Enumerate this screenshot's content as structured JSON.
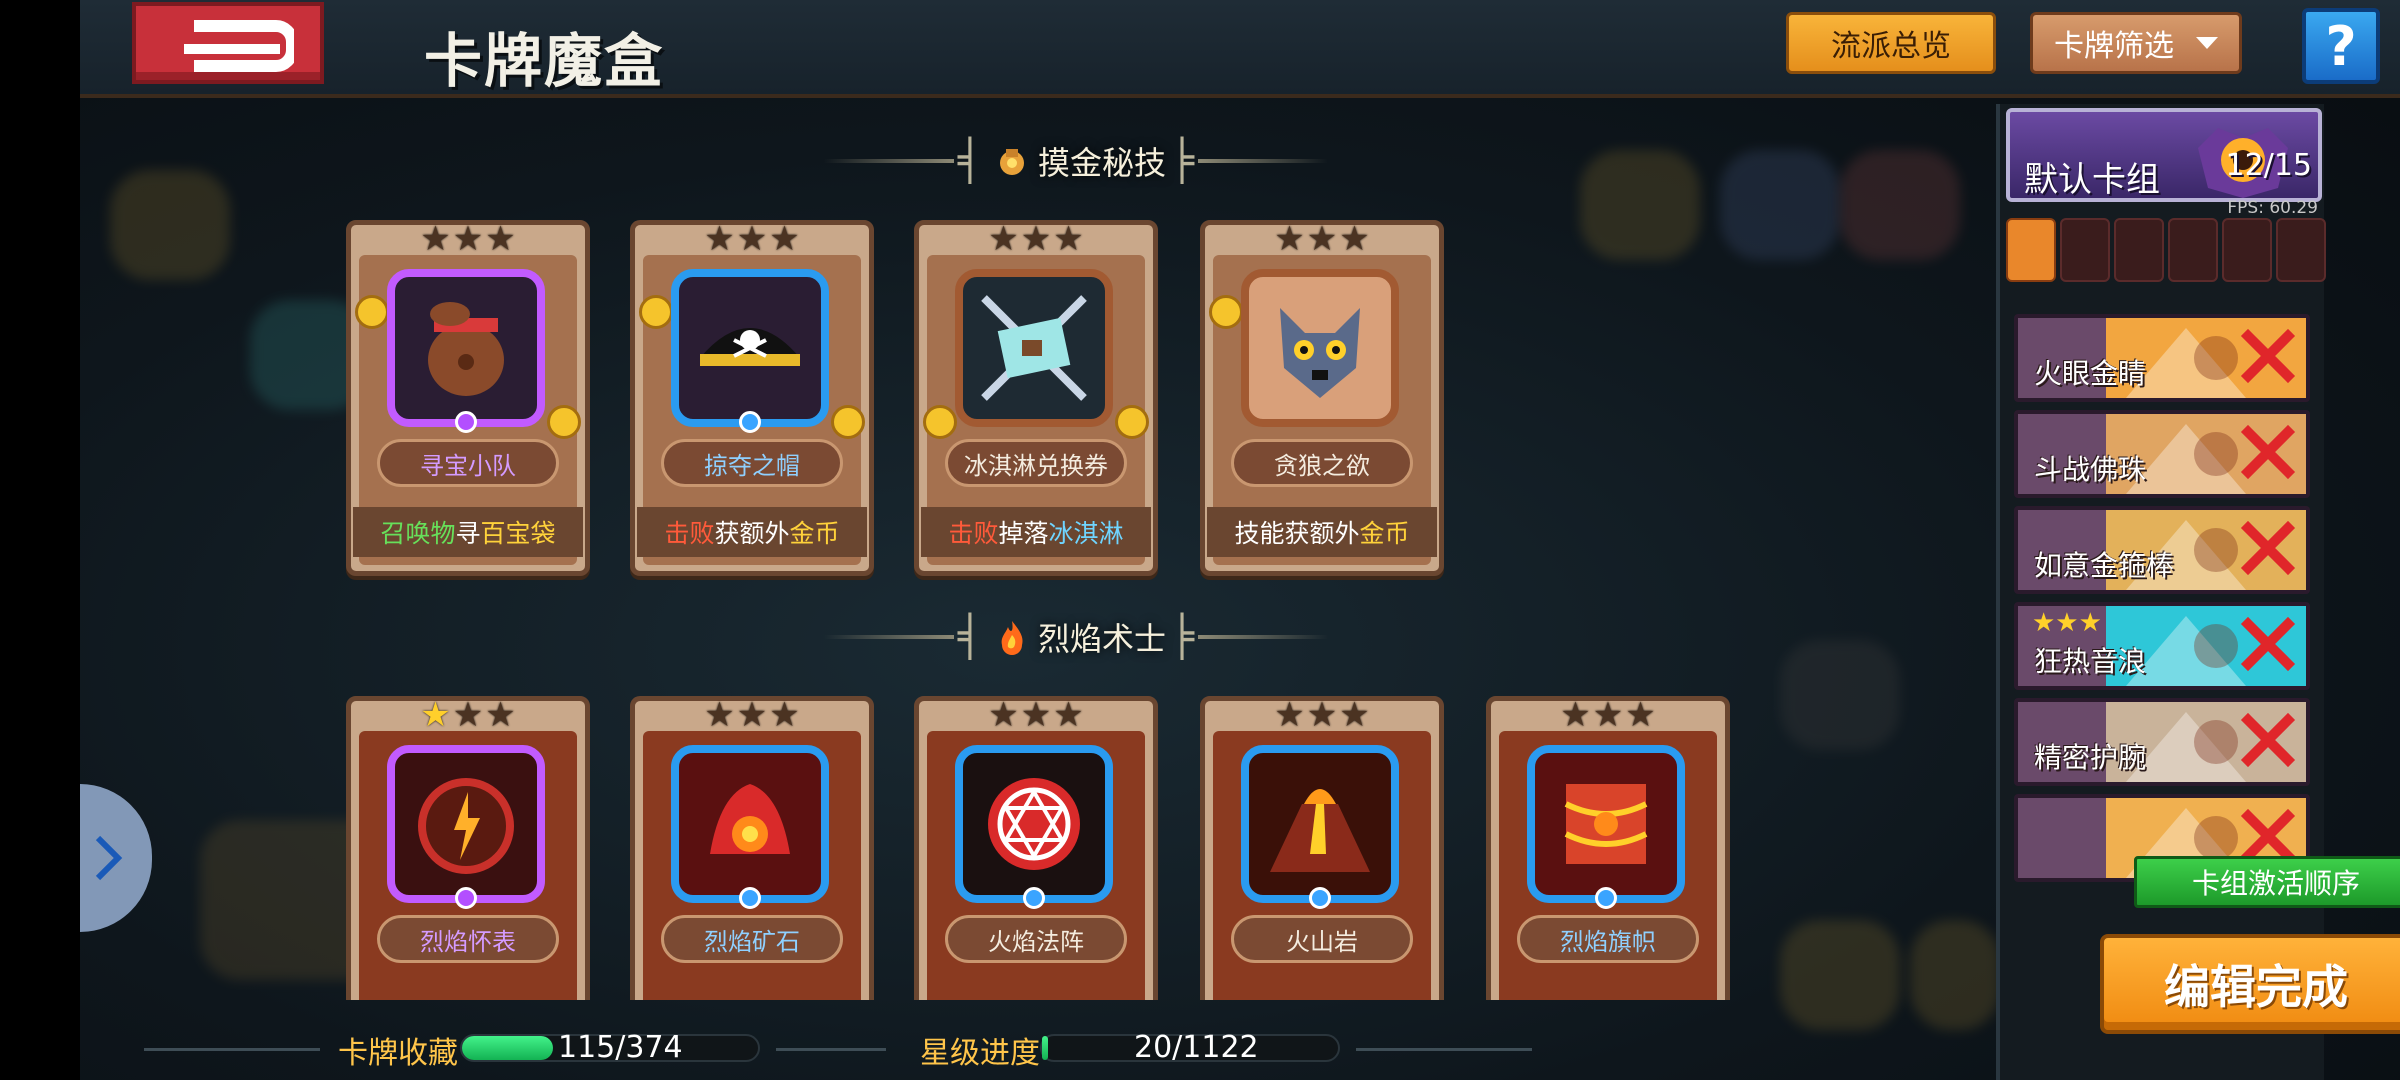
{
  "header": {
    "title": "卡牌魔盒",
    "overview_label": "流派总览",
    "filter_label": "卡牌筛选",
    "help_label": "?"
  },
  "sections": [
    {
      "title": "摸金秘技",
      "icon": "gold-bag-icon",
      "cards": [
        {
          "name": "寻宝小队",
          "rarity": "purple",
          "stars": 0,
          "desc": [
            {
              "t": "召唤物",
              "c": "#67e05a"
            },
            {
              "t": "寻",
              "c": "#ffffff"
            },
            {
              "t": "百宝袋",
              "c": "#ffd23a"
            }
          ]
        },
        {
          "name": "掠夺之帽",
          "rarity": "blue",
          "stars": 0,
          "desc": [
            {
              "t": "击败",
              "c": "#ff5a3a"
            },
            {
              "t": "获额外",
              "c": "#ffffff"
            },
            {
              "t": "金币",
              "c": "#ffd23a"
            }
          ]
        },
        {
          "name": "冰淇淋兑换券",
          "rarity": "white",
          "stars": 0,
          "desc": [
            {
              "t": "击败",
              "c": "#ff5a3a"
            },
            {
              "t": "掉落",
              "c": "#ffffff"
            },
            {
              "t": "冰淇淋",
              "c": "#6fd5ff"
            }
          ]
        },
        {
          "name": "贪狼之欲",
          "rarity": "white",
          "stars": 0,
          "desc": [
            {
              "t": "技能获额外",
              "c": "#ffffff"
            },
            {
              "t": "金币",
              "c": "#ffd23a"
            }
          ]
        }
      ]
    },
    {
      "title": "烈焰术士",
      "icon": "flame-icon",
      "cards": [
        {
          "name": "烈焰怀表",
          "rarity": "purple",
          "stars": 1,
          "desc": []
        },
        {
          "name": "烈焰矿石",
          "rarity": "blue",
          "stars": 0,
          "desc": []
        },
        {
          "name": "火焰法阵",
          "rarity": "blue",
          "stars": 0,
          "desc": []
        },
        {
          "name": "火山岩",
          "rarity": "blue",
          "stars": 0,
          "desc": []
        },
        {
          "name": "烈焰旗帜",
          "rarity": "blue",
          "stars": 0,
          "desc": []
        }
      ]
    }
  ],
  "deck": {
    "name": "默认卡组",
    "count": "12/15",
    "fps": "FPS: 60.29",
    "relic_slots": 6,
    "relic_filled": 1,
    "items": [
      {
        "name": "火眼金睛",
        "color": "#f2a640",
        "stars": 0
      },
      {
        "name": "斗战佛珠",
        "color": "#e0a562",
        "stars": 0
      },
      {
        "name": "如意金箍棒",
        "color": "#e3b15a",
        "stars": 0
      },
      {
        "name": "狂热音浪",
        "color": "#2ec7d8",
        "stars": 3
      },
      {
        "name": "精密护腕",
        "color": "#c9b39a",
        "stars": 0
      },
      {
        "name": "",
        "color": "#f0b050",
        "stars": 0
      }
    ],
    "activate_label": "卡组激活顺序",
    "done_label": "编辑完成"
  },
  "footer": {
    "collection_label": "卡牌收藏",
    "collection_text": "115/374",
    "collection_progress": 0.307,
    "star_label": "星级进度",
    "star_text": "20/1122",
    "star_progress": 0.018
  },
  "colors": {
    "accent_orange": "#f08a10",
    "accent_green": "#1d9a2a",
    "back_red": "#c8303a"
  }
}
